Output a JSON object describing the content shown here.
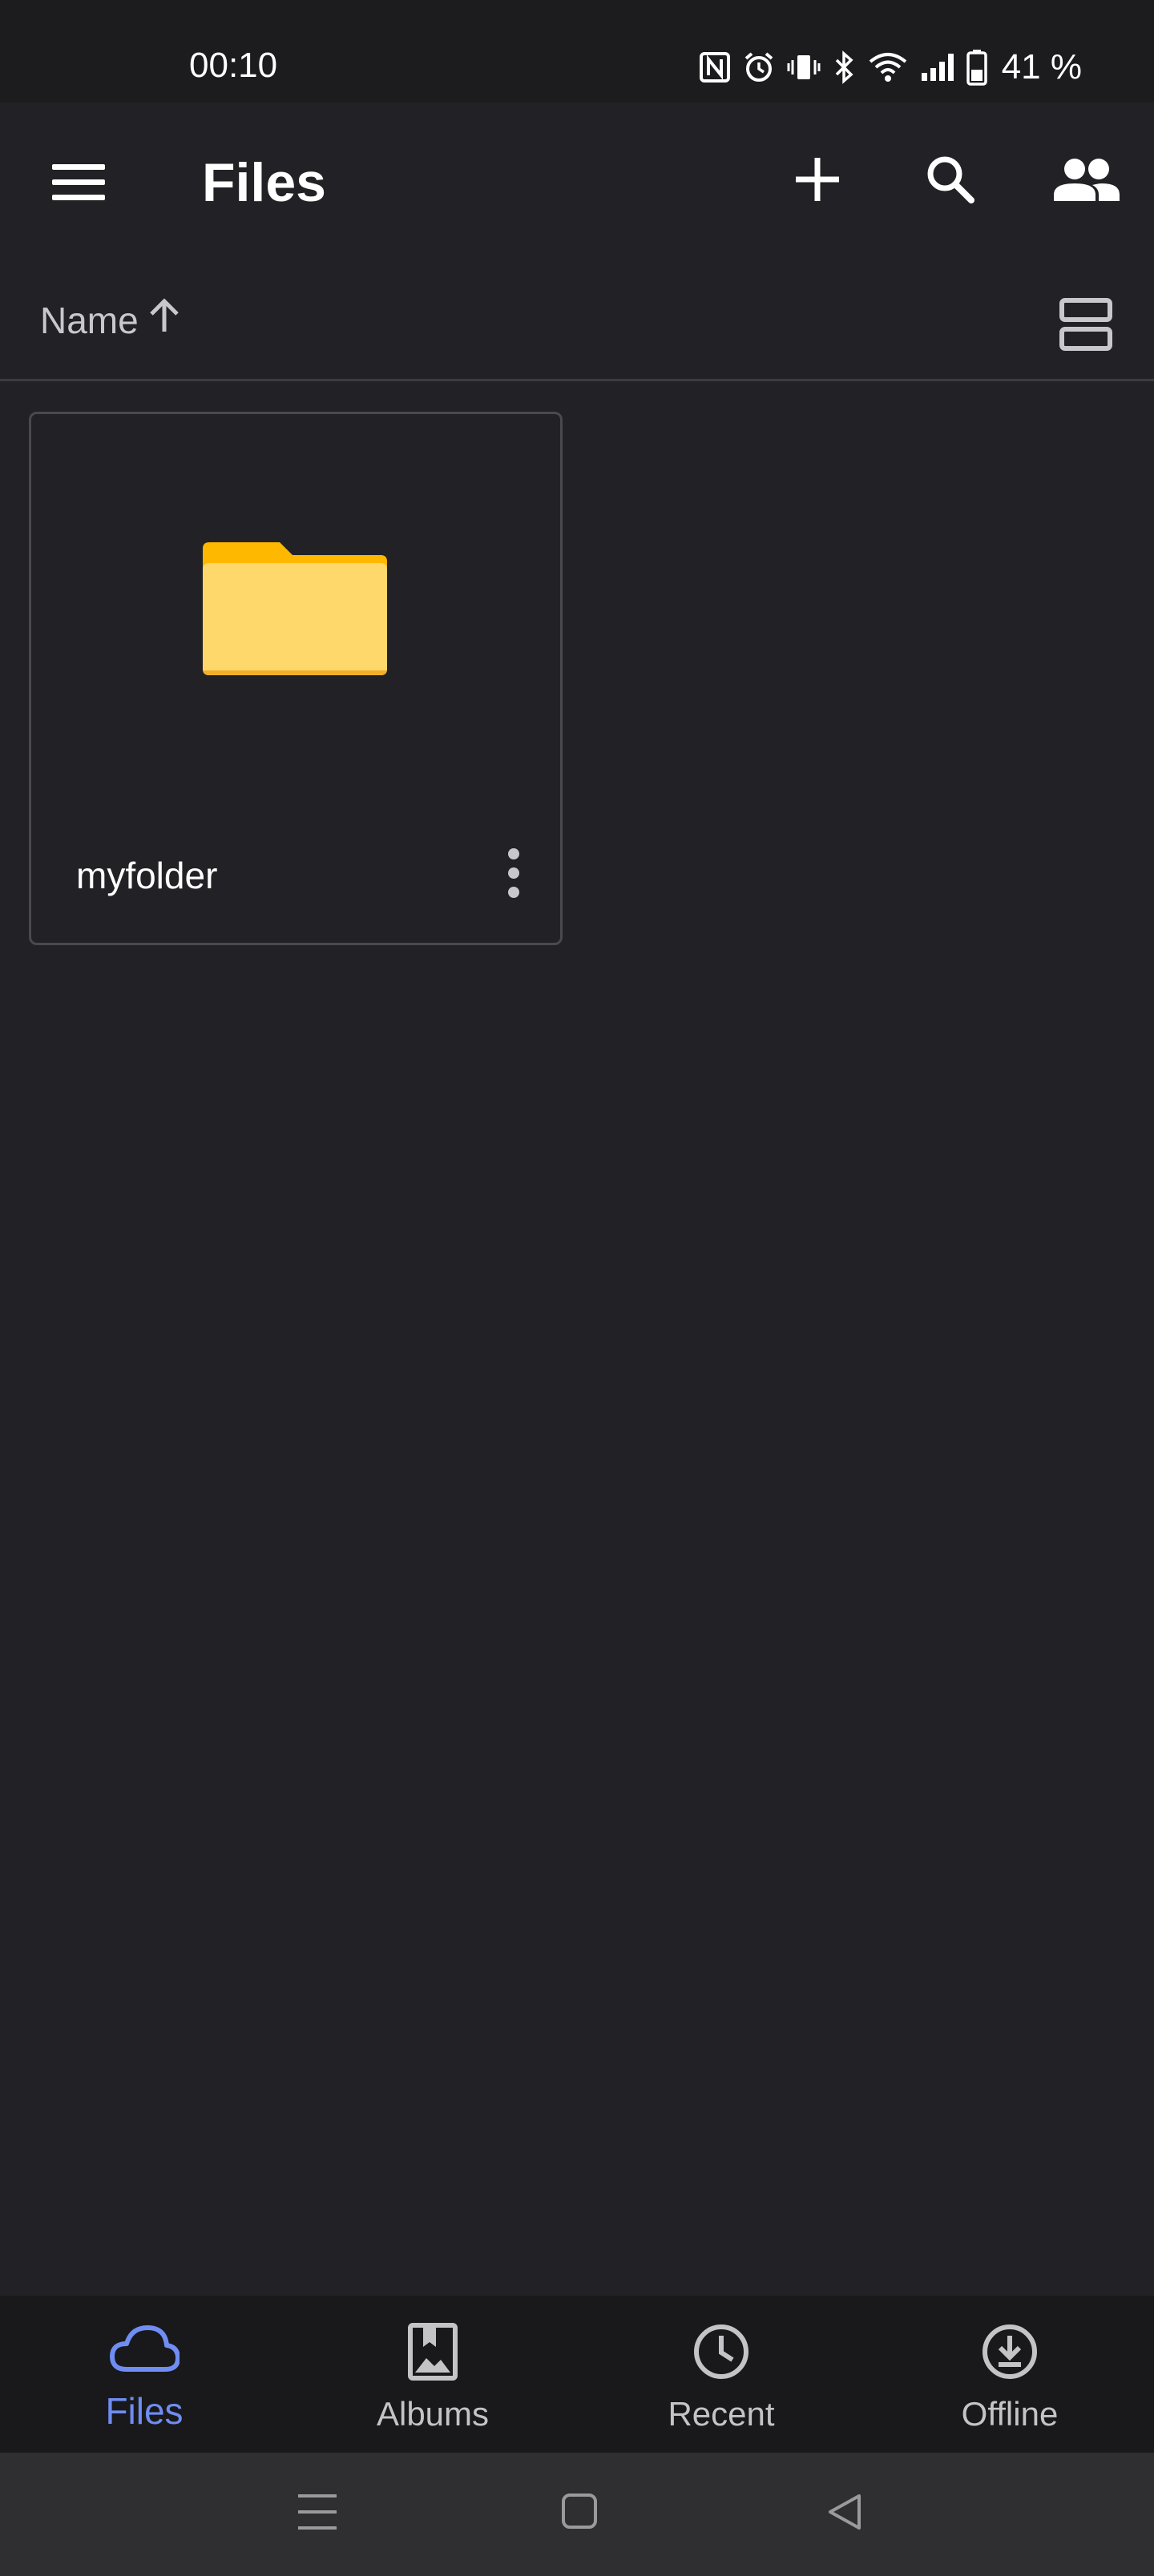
{
  "status_bar": {
    "time": "00:10",
    "battery_percent": "41 %",
    "icons": [
      "nfc-icon",
      "alarm-icon",
      "vibrate-icon",
      "bluetooth-icon",
      "wifi-icon",
      "signal-icon",
      "battery-icon"
    ]
  },
  "app_bar": {
    "title": "Files",
    "icons": [
      "menu-icon",
      "add-icon",
      "search-icon",
      "people-icon"
    ]
  },
  "sort_bar": {
    "label": "Name",
    "direction_icon": "arrow-up-icon",
    "view_toggle_icon": "list-view-icon"
  },
  "files": [
    {
      "name": "myfolder",
      "type": "folder",
      "icon": "folder-icon",
      "menu_icon": "more-vert-icon"
    }
  ],
  "bottom_nav": {
    "active": "Files",
    "items": [
      {
        "label": "Files",
        "icon": "cloud-icon"
      },
      {
        "label": "Albums",
        "icon": "albums-icon"
      },
      {
        "label": "Recent",
        "icon": "clock-icon"
      },
      {
        "label": "Offline",
        "icon": "download-icon"
      }
    ]
  },
  "colors": {
    "background": "#222226",
    "accent": "#6f8df2",
    "folder_body": "#ffd86b",
    "folder_tab": "#ffb800"
  }
}
